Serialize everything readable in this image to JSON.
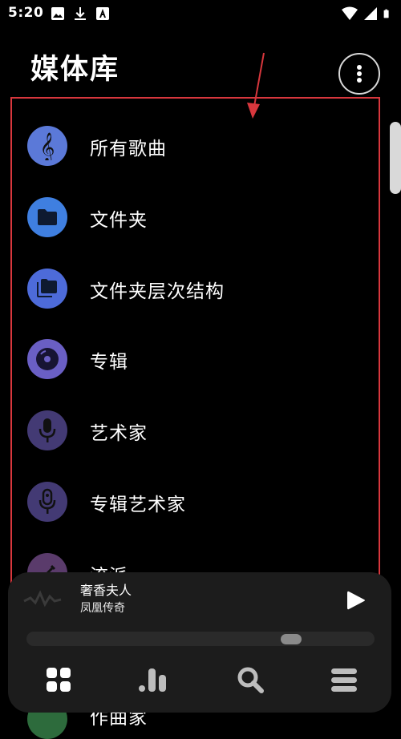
{
  "status_bar": {
    "time": "5:20",
    "left_icons": [
      "image-icon",
      "download-icon",
      "a-text-icon"
    ],
    "right_icons": [
      "wifi-icon",
      "signal-icon",
      "battery-icon"
    ]
  },
  "header": {
    "title": "媒体库",
    "more_icon": "more-vertical-icon"
  },
  "library": {
    "items": [
      {
        "label": "所有歌曲",
        "icon": "treble-clef-icon",
        "color": "#5b79d8"
      },
      {
        "label": "文件夹",
        "icon": "folder-icon",
        "color": "#3f7fe0"
      },
      {
        "label": "文件夹层次结构",
        "icon": "folder-tree-icon",
        "color": "#4d6bd9"
      },
      {
        "label": "专辑",
        "icon": "disc-icon",
        "color": "#6a5fc4"
      },
      {
        "label": "艺术家",
        "icon": "microphone-icon",
        "color": "#433a74"
      },
      {
        "label": "专辑艺术家",
        "icon": "microphone-outline-icon",
        "color": "#433a74"
      },
      {
        "label": "流派",
        "icon": "guitar-icon",
        "color": "#5a3b6b"
      },
      {
        "label": "作曲家",
        "icon": "composer-icon",
        "color": "#2d6b3c"
      }
    ]
  },
  "now_playing": {
    "title": "奢香夫人",
    "artist": "凤凰传奇",
    "play_icon": "play-icon",
    "progress": 0.75
  },
  "bottom_nav": {
    "items": [
      {
        "name": "library-tab",
        "icon": "grid-icon"
      },
      {
        "name": "stats-tab",
        "icon": "bar-chart-icon"
      },
      {
        "name": "search-tab",
        "icon": "search-icon"
      },
      {
        "name": "queue-tab",
        "icon": "menu-icon"
      }
    ]
  },
  "colors": {
    "background": "#000000",
    "player_bg": "#1c1c1c",
    "annotation": "#d8373d"
  }
}
